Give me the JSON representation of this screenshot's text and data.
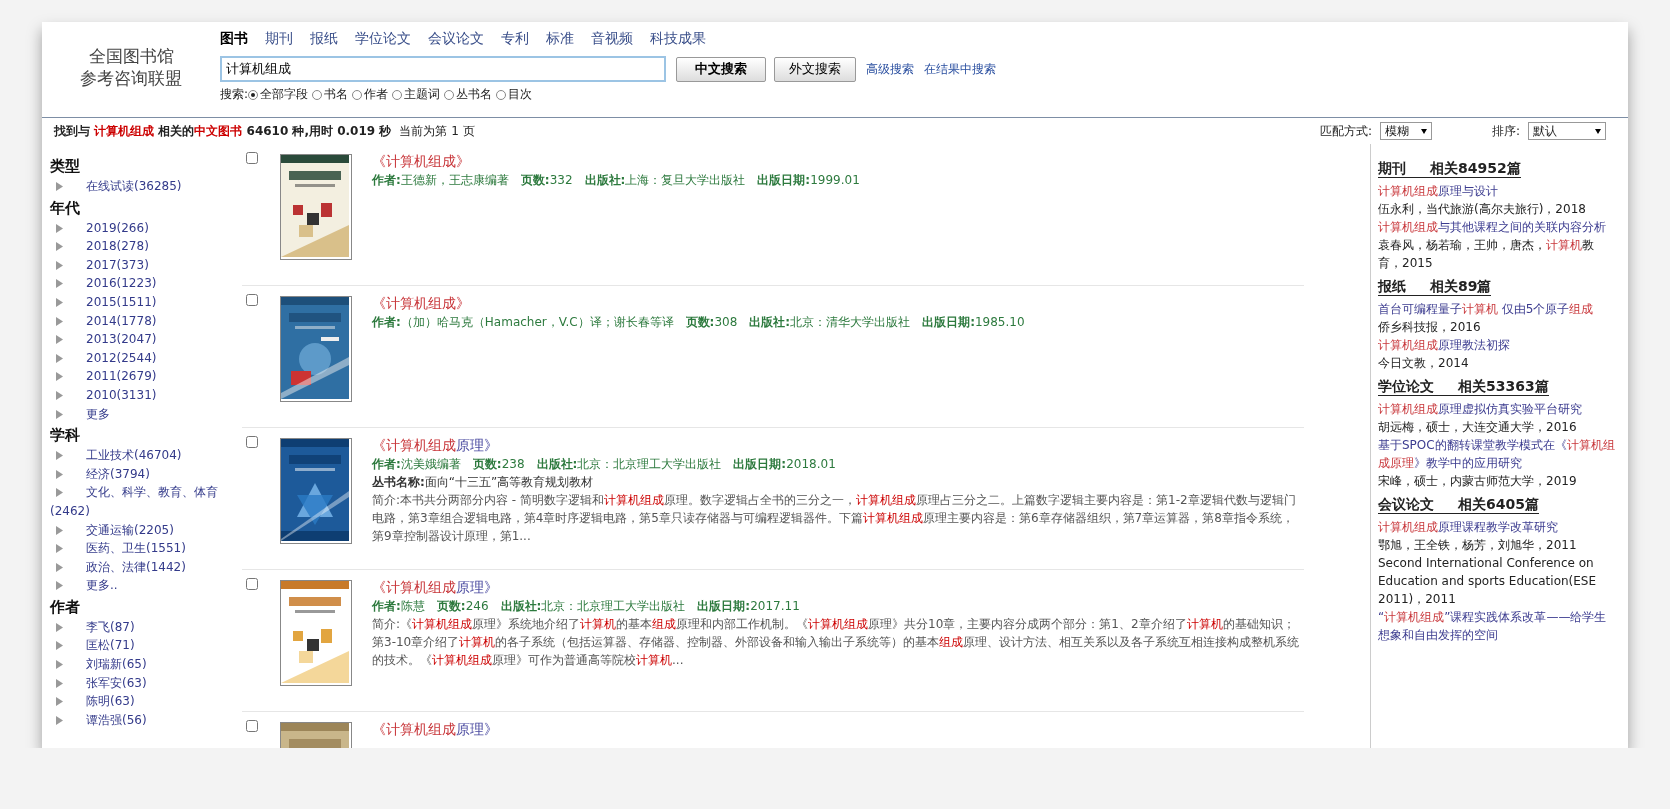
{
  "logo": {
    "lines": [
      "全国图书馆",
      "参考咨询联盟"
    ]
  },
  "tabs": [
    {
      "label": "图书",
      "selected": true
    },
    {
      "label": "期刊",
      "selected": false
    },
    {
      "label": "报纸",
      "selected": false
    },
    {
      "label": "学位论文",
      "selected": false
    },
    {
      "label": "会议论文",
      "selected": false
    },
    {
      "label": "专利",
      "selected": false
    },
    {
      "label": "标准",
      "selected": false
    },
    {
      "label": "音视频",
      "selected": false
    },
    {
      "label": "科技成果",
      "selected": false
    }
  ],
  "search": {
    "value": "计算机组成",
    "buttons": [
      "中文搜索",
      "外文搜索"
    ],
    "links": [
      "高级搜索",
      "在结果中搜索"
    ],
    "scope_label": "搜索:",
    "scopes": [
      {
        "label": "全部字段",
        "selected": true
      },
      {
        "label": "书名",
        "selected": false
      },
      {
        "label": "作者",
        "selected": false
      },
      {
        "label": "主题词",
        "selected": false
      },
      {
        "label": "丛书名",
        "selected": false
      },
      {
        "label": "目次",
        "selected": false
      }
    ]
  },
  "status_bar": {
    "summary": "找到与 **计算机组成** 相关的**中文图书** 64610 种,用时 0.019 秒",
    "page": "当前为第 1 页",
    "match_label": "匹配方式:",
    "match_value": "模糊",
    "sort_label": "排序:",
    "sort_value": "默认"
  },
  "sidebar": {
    "groups": [
      {
        "heading": "类型",
        "items": [
          "在线试读(36285)"
        ]
      },
      {
        "heading": "年代",
        "items": [
          "2019(266)",
          "2018(278)",
          "2017(373)",
          "2016(1223)",
          "2015(1511)",
          "2014(1778)",
          "2013(2047)",
          "2012(2544)",
          "2011(2679)",
          "2010(3131)",
          "更多"
        ]
      },
      {
        "heading": "学科",
        "items": [
          "工业技术(46704)",
          "经济(3794)",
          "文化、科学、教育、体育(2462)",
          "交通运输(2205)",
          "医药、卫生(1551)",
          "政治、法律(1442)",
          "更多.."
        ]
      },
      {
        "heading": "作者",
        "items": [
          "李飞(87)",
          "匡松(71)",
          "刘瑞新(65)",
          "张军安(63)",
          "陈明(63)",
          "谭浩强(56)"
        ]
      }
    ]
  },
  "results": [
    {
      "checked": false,
      "title": "**《计算机组成》**",
      "meta": "**作者:**王德新，王志康编著　**页数:**332　**出版社:**上海：复旦大学出版社　**出版日期:**1999.01"
    },
    {
      "checked": false,
      "title": "**《计算机组成》**",
      "meta": "**作者:**（加）哈马克（Hamacher，V.C）译；谢长春等译　**页数:**308　**出版社:**北京：清华大学出版社　**出版日期:**1985.10"
    },
    {
      "checked": false,
      "title": "**《计算机组成**原理》",
      "meta": "**作者:**沈美娥编著　**页数:**238　**出版社:**北京：北京理工大学出版社　**出版日期:**2018.01",
      "series": "**丛书名称:**面向“十三五”高等教育规划教材",
      "abstract": "简介:本书共分两部分内容 - 简明数字逻辑和**计算机组成**原理。数字逻辑占全书的三分之一，**计算机组成**原理占三分之二。上篇数字逻辑主要内容是：第1-2章逻辑代数与逻辑门电路，第3章组合逻辑电路，第4章时序逻辑电路，第5章只读存储器与可编程逻辑器件。下篇**计算机组成**原理主要内容是：第6章存储器组织，第7章运算器，第8章指令系统，第9章控制器设计原理，第1..."
    },
    {
      "checked": false,
      "title": "**《计算机组成**原理》",
      "meta": "**作者:**陈慧　**页数:**246　**出版社:**北京：北京理工大学出版社　**出版日期:**2017.11",
      "abstract": "简介:《**计算机组成**原理》系统地介绍了**计算机**的基本**组成**原理和内部工作机制。《**计算机组成**原理》共分10章，主要内容分成两个部分：第1、2章介绍了**计算机**的基础知识；第3-10章介绍了**计算机**的各子系统（包括运算器、存储器、控制器、外部设备和输入输出子系统等）的基本**组成**原理、设计方法、相互关系以及各子系统互相连接构成整机系统的技术。《**计算机组成**原理》可作为普通高等院校**计算机**..."
    },
    {
      "checked": false,
      "title": "**《计算机组成**原理》"
    }
  ],
  "related": [
    {
      "title": "期刊",
      "count": "相关84952篇",
      "entries": [
        {
          "kind": "link",
          "text": "**计算机组成**原理与设计"
        },
        {
          "kind": "source",
          "text": "伍永利，当代旅游(高尔夫旅行)，2018"
        },
        {
          "kind": "link",
          "text": "**计算机组成**与其他课程之间的关联内容分析"
        },
        {
          "kind": "source",
          "text": "袁春风，杨若瑜，王帅，唐杰，**计算机**教育，2015"
        }
      ]
    },
    {
      "title": "报纸",
      "count": "相关89篇",
      "entries": [
        {
          "kind": "link",
          "text": "首台可编程量子**计算机** 仅由5个原子**组成**"
        },
        {
          "kind": "source",
          "text": "侨乡科技报，2016"
        },
        {
          "kind": "link",
          "text": "**计算机组成**原理教法初探"
        },
        {
          "kind": "source",
          "text": "今日文教，2014"
        }
      ]
    },
    {
      "title": "学位论文",
      "count": "相关53363篇",
      "entries": [
        {
          "kind": "link",
          "text": "**计算机组成**原理虚拟仿真实验平台研究"
        },
        {
          "kind": "source",
          "text": "胡远梅，硕士，大连交通大学，2016"
        },
        {
          "kind": "link",
          "text": "基于SPOC的翻转课堂教学模式在《**计算机组成原理**》教学中的应用研究"
        },
        {
          "kind": "source",
          "text": "宋峰，硕士，内蒙古师范大学，2019"
        }
      ]
    },
    {
      "title": "会议论文",
      "count": "相关6405篇",
      "entries": [
        {
          "kind": "link",
          "text": "**计算机组成**原理课程教学改革研究"
        },
        {
          "kind": "source",
          "text": "鄂旭，王全铁，杨芳，刘旭华，2011 Second International Conference on Education and sports Education(ESE 2011)，2011"
        },
        {
          "kind": "link",
          "text": "“**计算机组成**”课程实践体系改革——给学生想象和自由发挥的空间"
        }
      ]
    }
  ]
}
